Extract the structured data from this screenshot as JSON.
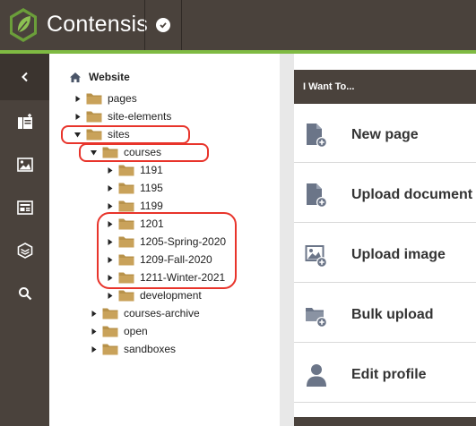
{
  "header": {
    "brand": "Contensis",
    "icons": [
      "leaf-logo-icon",
      "check-icon"
    ]
  },
  "nav": {
    "icons": [
      "chevron-left-icon",
      "add-content-icon",
      "image-icon",
      "form-icon",
      "layers-icon",
      "search-icon"
    ]
  },
  "tree": {
    "root": "Website",
    "items": [
      {
        "label": "pages",
        "expanded": false
      },
      {
        "label": "site-elements",
        "expanded": false
      },
      {
        "label": "sites",
        "expanded": true
      },
      {
        "label": "courses",
        "expanded": true
      },
      {
        "label": "1191",
        "expanded": false
      },
      {
        "label": "1195",
        "expanded": false
      },
      {
        "label": "1199",
        "expanded": false
      },
      {
        "label": "1201",
        "expanded": false
      },
      {
        "label": "1205-Spring-2020",
        "expanded": false
      },
      {
        "label": "1209-Fall-2020",
        "expanded": false
      },
      {
        "label": "1211-Winter-2021",
        "expanded": false
      },
      {
        "label": "development",
        "expanded": false
      },
      {
        "label": "courses-archive",
        "expanded": false
      },
      {
        "label": "open",
        "expanded": false
      },
      {
        "label": "sandboxes",
        "expanded": false
      }
    ]
  },
  "panel": {
    "title": "I Want To...",
    "items": [
      {
        "label": "New page",
        "icon": "new-page-icon"
      },
      {
        "label": "Upload document",
        "icon": "upload-document-icon"
      },
      {
        "label": "Upload image",
        "icon": "upload-image-icon"
      },
      {
        "label": "Bulk upload",
        "icon": "bulk-upload-icon"
      },
      {
        "label": "Edit profile",
        "icon": "edit-profile-icon"
      }
    ]
  },
  "colors": {
    "chrome": "#4a423c",
    "accent": "#7fba42",
    "folder": "#b8924a",
    "icon": "#6b7588",
    "highlight": "#e8342b"
  }
}
